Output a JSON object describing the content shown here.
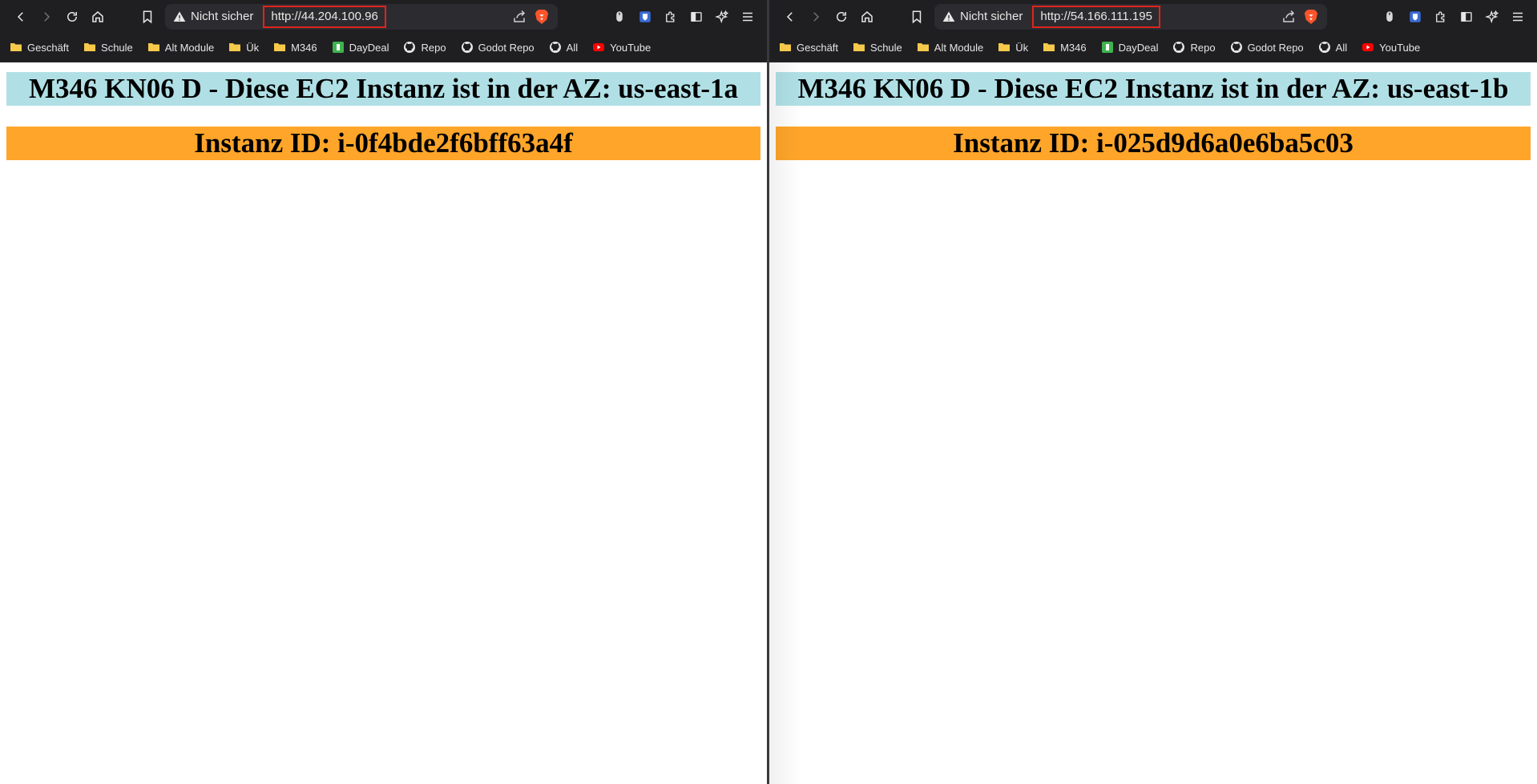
{
  "windows": [
    {
      "security_label": "Nicht sicher",
      "url": "http://44.204.100.96",
      "bookmarks": [
        "Geschäft",
        "Schule",
        "Alt Module",
        "Ük",
        "M346",
        "DayDeal",
        "Repo",
        "Godot Repo",
        "All",
        "YouTube"
      ],
      "heading_az": "M346 KN06 D - Diese EC2 Instanz ist in der AZ: us-east-1a",
      "heading_id": "Instanz ID: i-0f4bde2f6bff63a4f"
    },
    {
      "security_label": "Nicht sicher",
      "url": "http://54.166.111.195",
      "bookmarks": [
        "Geschäft",
        "Schule",
        "Alt Module",
        "Ük",
        "M346",
        "DayDeal",
        "Repo",
        "Godot Repo",
        "All",
        "YouTube"
      ],
      "heading_az": "M346 KN06 D - Diese EC2 Instanz ist in der AZ: us-east-1b",
      "heading_id": "Instanz ID: i-025d9d6a0e6ba5c03"
    }
  ],
  "bookmark_icons": [
    "folder-icon",
    "folder-icon",
    "folder-icon",
    "folder-icon",
    "folder-icon",
    "daydeal-icon",
    "github-icon",
    "github-icon",
    "github-icon",
    "youtube-icon"
  ],
  "colors": {
    "az_heading_bg": "#b0e0e6",
    "id_heading_bg": "#ffa52a",
    "toolbar_bg": "#1f1f22",
    "url_highlight": "#e0241c"
  }
}
